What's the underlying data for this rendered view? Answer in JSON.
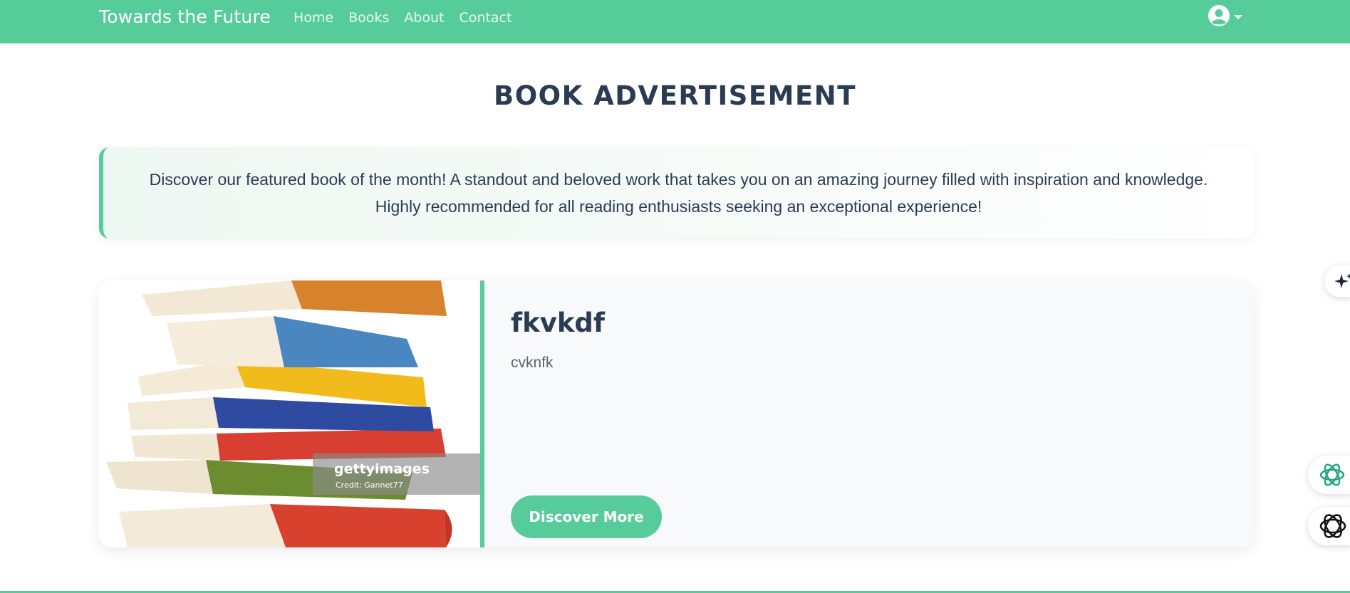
{
  "nav": {
    "brand": "Towards the Future",
    "links": [
      "Home",
      "Books",
      "About",
      "Contact"
    ]
  },
  "page": {
    "title": "BOOK ADVERTISEMENT"
  },
  "intro": {
    "text": "Discover our featured book of the month! A standout and beloved work that takes you on an amazing journey filled with inspiration and knowledge. Highly recommended for all reading enthusiasts seeking an exceptional experience!"
  },
  "book": {
    "title": "fkvkdf",
    "description": "cvknfk",
    "button_label": "Discover More",
    "image_watermark": "gettyimages",
    "image_credit": "Credit: Gannet77"
  },
  "icons": {
    "user": "user-circle-icon",
    "caret": "caret-down-icon",
    "sparkle": "sparkle-icon",
    "assistant": "openai-icon",
    "assistant2": "ai-assistant-icon"
  },
  "colors": {
    "accent": "#57cc9b",
    "heading": "#2b3c52",
    "text_muted": "#5a6572",
    "card_bg": "#f7f9fb"
  }
}
